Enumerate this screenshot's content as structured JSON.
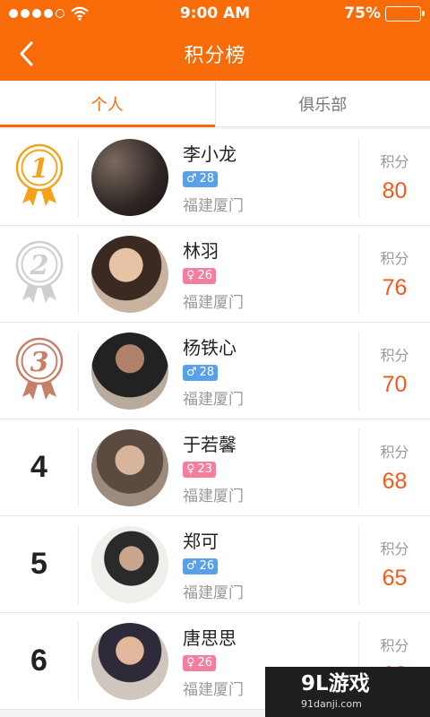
{
  "status_bar": {
    "time": "9:00 AM",
    "battery": "75%",
    "battery_level": 0.75,
    "signal_bars": 4
  },
  "header": {
    "title": "积分榜",
    "back_icon": "chevron-left-icon"
  },
  "tabs": [
    {
      "label": "个人",
      "active": true
    },
    {
      "label": "俱乐部",
      "active": false
    }
  ],
  "score_label": "积分",
  "medal_colors": {
    "gold": "#f4a21b",
    "silver": "#cfcfcf",
    "bronze": "#c77f6a"
  },
  "entries": [
    {
      "rank": "1",
      "name": "李小龙",
      "gender_symbol": "♂",
      "gender": "male",
      "age": "28",
      "location": "福建厦门",
      "score": "80"
    },
    {
      "rank": "2",
      "name": "林羽",
      "gender_symbol": "♀",
      "gender": "female",
      "age": "26",
      "location": "福建厦门",
      "score": "76"
    },
    {
      "rank": "3",
      "name": "杨铁心",
      "gender_symbol": "♂",
      "gender": "male",
      "age": "28",
      "location": "福建厦门",
      "score": "70"
    },
    {
      "rank": "4",
      "name": "于若馨",
      "gender_symbol": "♀",
      "gender": "female",
      "age": "23",
      "location": "福建厦门",
      "score": "68"
    },
    {
      "rank": "5",
      "name": "郑可",
      "gender_symbol": "♂",
      "gender": "male",
      "age": "26",
      "location": "福建厦门",
      "score": "65"
    },
    {
      "rank": "6",
      "name": "唐思思",
      "gender_symbol": "♀",
      "gender": "female",
      "age": "26",
      "location": "福建厦门",
      "score": "63"
    }
  ],
  "watermark": {
    "main": "9L游戏",
    "sub": "91danji.com"
  }
}
